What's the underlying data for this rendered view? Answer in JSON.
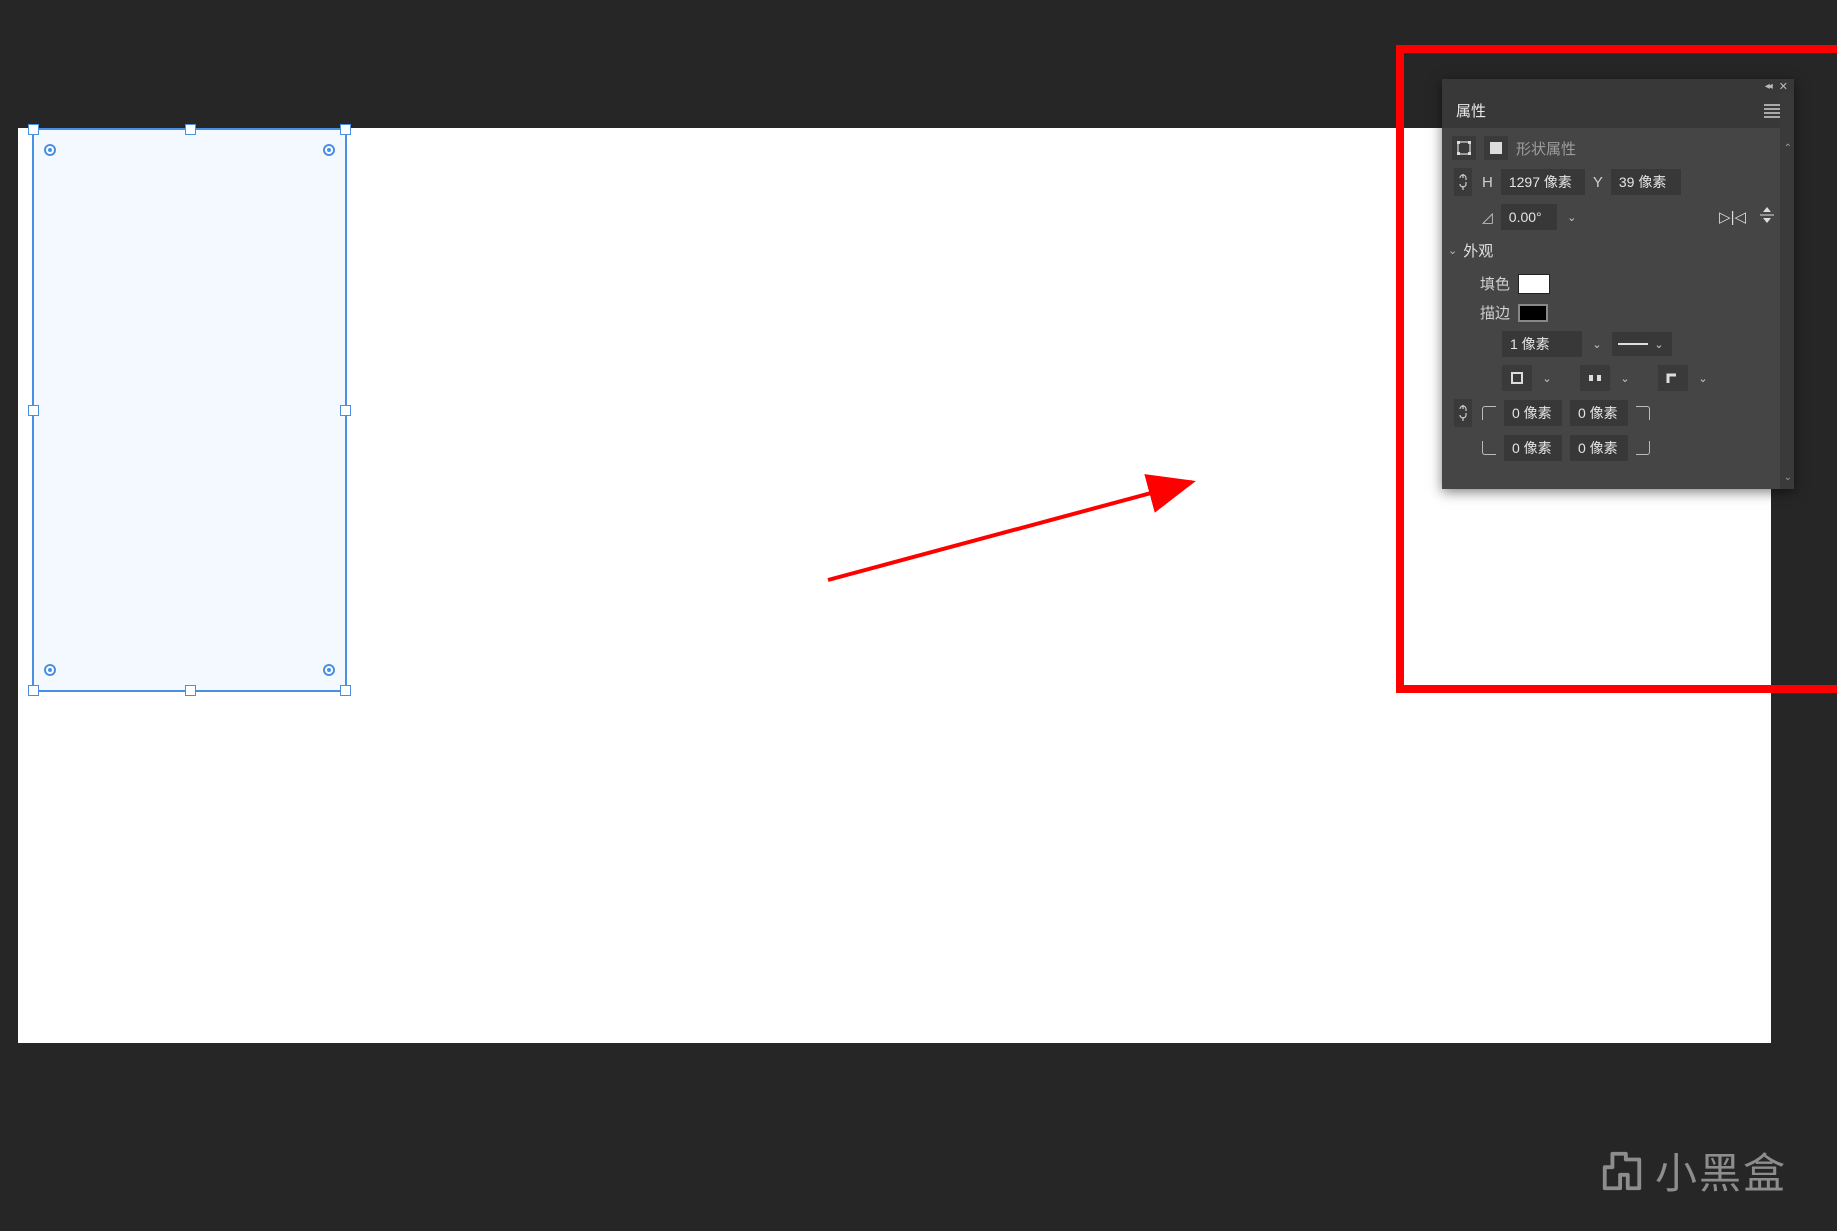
{
  "panel": {
    "title": "属性",
    "shape_type_label": "形状属性",
    "H_label": "H",
    "H_value": "1297 像素",
    "Y_label": "Y",
    "Y_value": "39 像素",
    "angle_value": "0.00°",
    "appearance_title": "外观",
    "fill_label": "填色",
    "stroke_label": "描边",
    "stroke_width": "1 像素",
    "corners": {
      "tl": "0 像素",
      "tr": "0 像素",
      "bl": "0 像素",
      "br": "0 像素"
    }
  },
  "colors": {
    "fill": "#ffffff",
    "stroke": "#000000",
    "annotation": "#ff0000",
    "selection": "#4a90e2",
    "canvas_bg": "#ffffff",
    "app_bg": "#262626",
    "panel_bg": "#454545"
  },
  "watermark": {
    "text": "小黑盒"
  }
}
